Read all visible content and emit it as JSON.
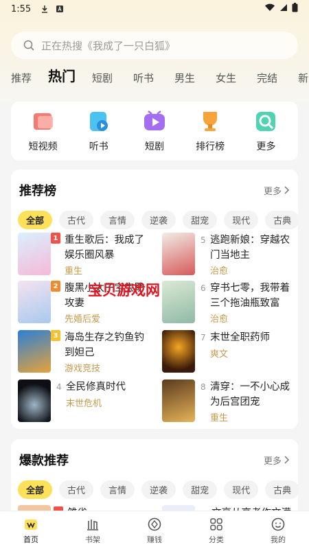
{
  "status_bar": {
    "time": "1:55"
  },
  "search": {
    "placeholder": "正在热搜《我成了一只白狐》"
  },
  "tabs": [
    {
      "label": "推荐"
    },
    {
      "label": "热门"
    },
    {
      "label": "短剧"
    },
    {
      "label": "听书"
    },
    {
      "label": "男生"
    },
    {
      "label": "女生"
    },
    {
      "label": "完结"
    },
    {
      "label": "新"
    }
  ],
  "quick_links": [
    {
      "label": "短视频",
      "icon": "short-video-icon"
    },
    {
      "label": "听书",
      "icon": "audiobook-icon"
    },
    {
      "label": "短剧",
      "icon": "short-drama-icon"
    },
    {
      "label": "排行榜",
      "icon": "trophy-icon"
    },
    {
      "label": "更多",
      "icon": "more-icon"
    }
  ],
  "ranking": {
    "title": "推荐榜",
    "more": "更多",
    "chips": [
      "全部",
      "古代",
      "言情",
      "逆袭",
      "甜宠",
      "现代",
      "古典"
    ],
    "books": [
      {
        "rank": "1",
        "title": "重生歌后：我成了娱乐圈风暴",
        "tag": "重生"
      },
      {
        "rank": "2",
        "title": "腹黑小太子宝宝助攻妻",
        "tag": "先婚后爱"
      },
      {
        "rank": "3",
        "title": "海岛生存之钓鱼钓到妲己",
        "tag": "游戏竞技"
      },
      {
        "rank": "4",
        "title": "全民修真时代",
        "tag": "末世危机"
      },
      {
        "rank": "5",
        "title": "逃跑新娘：穿越农门当地主",
        "tag": "治愈"
      },
      {
        "rank": "6",
        "title": "穿书七零，我带着三个拖油瓶致富",
        "tag": "治愈"
      },
      {
        "rank": "7",
        "title": "末世全职药师",
        "tag": "爽文"
      },
      {
        "rank": "8",
        "title": "清穿：一不小心成为后宫团宠",
        "tag": "重生"
      }
    ]
  },
  "watermark": "宝贝游戏网",
  "hot": {
    "title": "爆款推荐",
    "more": "更多",
    "chips": [
      "全部",
      "古代",
      "言情",
      "逆袭",
      "甜宠",
      "现代",
      "古典"
    ],
    "peek_left": "雏雀",
    "peek_right": "文亭从高考作文满"
  },
  "bottom_nav": [
    {
      "label": "首页",
      "icon": "home-icon"
    },
    {
      "label": "书架",
      "icon": "bookshelf-icon"
    },
    {
      "label": "赚钱",
      "icon": "earn-icon"
    },
    {
      "label": "分类",
      "icon": "category-icon"
    },
    {
      "label": "我的",
      "icon": "profile-icon"
    }
  ],
  "colors": {
    "accent": "#fde15a",
    "tag": "#c59a4d",
    "badge1": "#f0524b",
    "badge2": "#f08a2e",
    "badge3": "#f6c02e"
  }
}
